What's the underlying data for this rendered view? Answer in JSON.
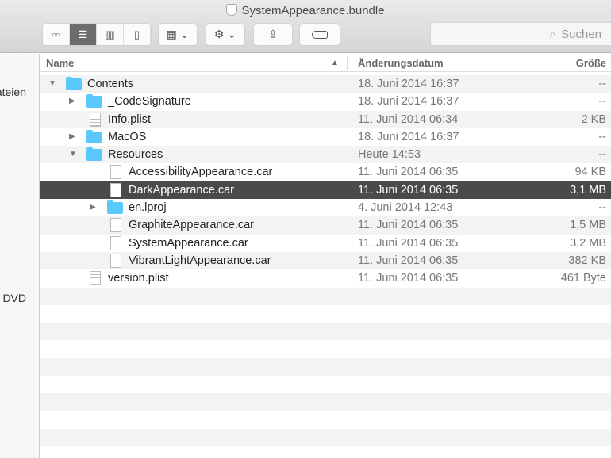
{
  "window": {
    "title": "SystemAppearance.bundle"
  },
  "toolbar": {
    "views": [
      "icon",
      "list",
      "column",
      "coverflow"
    ],
    "arrange": "arrange-icon",
    "action": "gear-icon",
    "share": "share-icon",
    "tags": "tag-icon",
    "search_placeholder": "Suchen"
  },
  "sidebar": {
    "items": [
      "Dateien",
      "DVD"
    ]
  },
  "columns": {
    "name": "Name",
    "date": "Änderungsdatum",
    "size": "Größe"
  },
  "rows": [
    {
      "name": "Contents",
      "date": "18. Juni 2014 16:37",
      "size": "--"
    },
    {
      "name": "_CodeSignature",
      "date": "18. Juni 2014 16:37",
      "size": "--"
    },
    {
      "name": "Info.plist",
      "date": "11. Juni 2014 06:34",
      "size": "2 KB"
    },
    {
      "name": "MacOS",
      "date": "18. Juni 2014 16:37",
      "size": "--"
    },
    {
      "name": "Resources",
      "date": "Heute 14:53",
      "size": "--"
    },
    {
      "name": "AccessibilityAppearance.car",
      "date": "11. Juni 2014 06:35",
      "size": "94 KB"
    },
    {
      "name": "DarkAppearance.car",
      "date": "11. Juni 2014 06:35",
      "size": "3,1 MB"
    },
    {
      "name": "en.lproj",
      "date": "4. Juni 2014 12:43",
      "size": "--"
    },
    {
      "name": "GraphiteAppearance.car",
      "date": "11. Juni 2014 06:35",
      "size": "1,5 MB"
    },
    {
      "name": "SystemAppearance.car",
      "date": "11. Juni 2014 06:35",
      "size": "3,2 MB"
    },
    {
      "name": "VibrantLightAppearance.car",
      "date": "11. Juni 2014 06:35",
      "size": "382 KB"
    },
    {
      "name": "version.plist",
      "date": "11. Juni 2014 06:35",
      "size": "461 Byte"
    }
  ]
}
